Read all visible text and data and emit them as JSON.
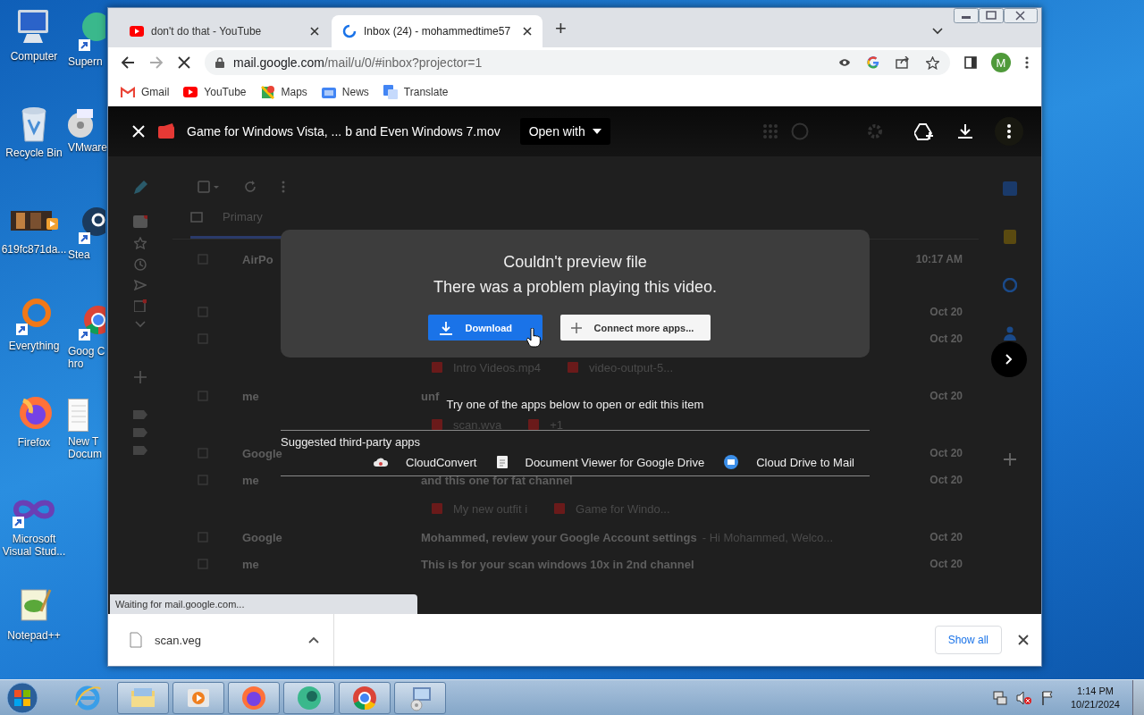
{
  "desktop_icons": [
    {
      "label": "Computer",
      "kind": "computer"
    },
    {
      "label": "Recycle Bin",
      "kind": "recycle"
    },
    {
      "label": "619fc871da...",
      "kind": "video"
    },
    {
      "label": "Everything",
      "kind": "everything"
    },
    {
      "label": "Firefox",
      "kind": "firefox"
    },
    {
      "label": "Microsoft Visual Stud...",
      "kind": "vs"
    },
    {
      "label": "Notepad++",
      "kind": "notepad"
    },
    {
      "label": "Supern",
      "kind": "orb"
    },
    {
      "label": "VMware",
      "kind": "disc"
    },
    {
      "label": "Stea",
      "kind": "steam"
    },
    {
      "label": "Goog Chro",
      "kind": "chrome"
    },
    {
      "label": "New T Docum",
      "kind": "doc"
    }
  ],
  "browser": {
    "tabs": [
      {
        "title": "don't do that - YouTube",
        "kind": "youtube",
        "selected": false
      },
      {
        "title": "Inbox (24) - mohammedtime57",
        "kind": "loading",
        "selected": true
      }
    ],
    "new_tab": "+",
    "address": {
      "host": "mail.google.com",
      "path": "/mail/u/0/#inbox?projector=1"
    },
    "profile": "M",
    "bookmarks": [
      {
        "label": "Gmail",
        "kind": "gmail"
      },
      {
        "label": "YouTube",
        "kind": "youtube"
      },
      {
        "label": "Maps",
        "kind": "maps"
      },
      {
        "label": "News",
        "kind": "news"
      },
      {
        "label": "Translate",
        "kind": "translate"
      }
    ],
    "status": "Waiting for mail.google.com...",
    "download": {
      "file": "scan.veg",
      "show_all": "Show all"
    }
  },
  "gmail": {
    "tab": "Primary",
    "rows": [
      {
        "kind": "mail",
        "sender": "AirPo",
        "date": "10:17 AM"
      },
      {
        "kind": "mail",
        "date": "Oct 20"
      },
      {
        "kind": "mail",
        "date": "Oct 20"
      },
      {
        "kind": "attachments",
        "files": [
          "Intro Videos.mp4",
          "video-output-5..."
        ]
      },
      {
        "kind": "mail",
        "sender": "me",
        "subject": "unf",
        "date": "Oct 20"
      },
      {
        "kind": "attachments",
        "files": [
          "scan.wva",
          "+1"
        ]
      },
      {
        "kind": "mail",
        "sender": "Google",
        "date": "Oct 20"
      },
      {
        "kind": "mail",
        "sender": "me",
        "subject": "and this one for fat channel",
        "date": "Oct 20"
      },
      {
        "kind": "attachments",
        "files": [
          "My new outfit i",
          "Game for Windo..."
        ]
      },
      {
        "kind": "mail",
        "sender": "Google",
        "subject": "Mohammed, review your Google Account settings",
        "snippet": "- Hi Mohammed, Welco...",
        "date": "Oct 20"
      },
      {
        "kind": "mail",
        "sender": "me",
        "subject": "This is for your scan windows 10x in 2nd channel",
        "date": "Oct 20"
      }
    ]
  },
  "viewer": {
    "file_name": "Game for Windows Vista, ... b and Even Windows 7.mov",
    "open_with": "Open with",
    "dialog": {
      "title": "Couldn't preview file",
      "message": "There was a problem playing this video.",
      "buttons": [
        {
          "label": "Download",
          "kind": "primary"
        },
        {
          "label": "Connect more apps...",
          "kind": "secondary"
        }
      ]
    },
    "hint": "Try one of the apps below to open or edit this item",
    "apps_heading": "Suggested third-party apps",
    "apps": [
      {
        "name": "CloudConvert",
        "kind": "cloud"
      },
      {
        "name": "Document Viewer for Google Drive",
        "kind": "document"
      },
      {
        "name": "Cloud Drive to Mail",
        "kind": "mail"
      }
    ]
  },
  "taskbar": {
    "apps": [
      {
        "kind": "ie",
        "running": false
      },
      {
        "kind": "explorer",
        "running": true
      },
      {
        "kind": "media",
        "running": true
      },
      {
        "kind": "firefox",
        "running": true
      },
      {
        "kind": "orb",
        "running": true
      },
      {
        "kind": "chrome",
        "running": true
      },
      {
        "kind": "setup",
        "running": true
      }
    ],
    "time": "1:14 PM",
    "date": "10/21/2024"
  }
}
